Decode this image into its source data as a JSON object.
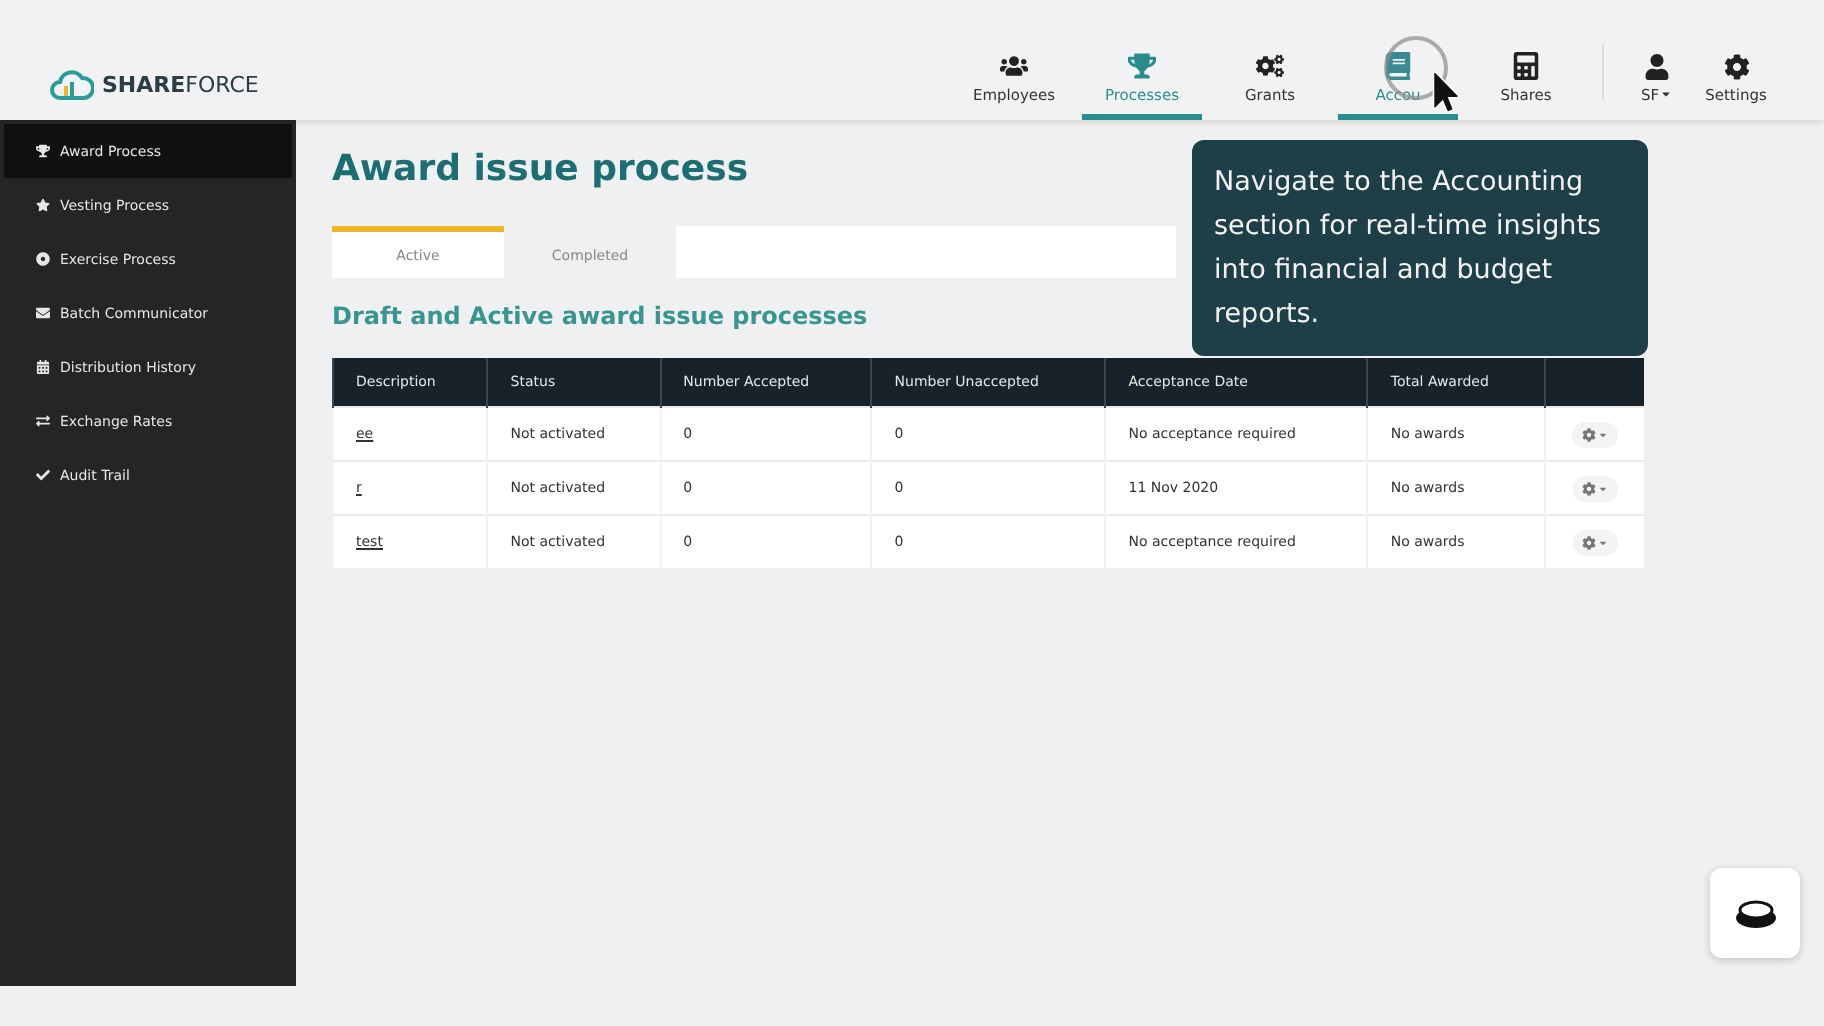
{
  "logo": {
    "text_bold": "SHARE",
    "text_light": "FORCE"
  },
  "nav": [
    {
      "label": "Employees",
      "selected": false,
      "hovered": false
    },
    {
      "label": "Processes",
      "selected": true,
      "hovered": false
    },
    {
      "label": "Grants",
      "selected": false,
      "hovered": false
    },
    {
      "label": "Accou",
      "selected": false,
      "hovered": true
    },
    {
      "label": "Shares",
      "selected": false,
      "hovered": false
    }
  ],
  "user": {
    "label": "SF"
  },
  "settings": {
    "label": "Settings"
  },
  "sidebar": {
    "items": [
      {
        "label": "Award Process",
        "selected": true
      },
      {
        "label": "Vesting Process",
        "selected": false
      },
      {
        "label": "Exercise Process",
        "selected": false
      },
      {
        "label": "Batch Communicator",
        "selected": false
      },
      {
        "label": "Distribution History",
        "selected": false
      },
      {
        "label": "Exchange Rates",
        "selected": false
      },
      {
        "label": "Audit Trail",
        "selected": false
      }
    ]
  },
  "page_title": "Award issue process",
  "tabs": [
    {
      "label": "Active",
      "selected": true
    },
    {
      "label": "Completed",
      "selected": false
    }
  ],
  "section_title": "Draft and Active award issue processes",
  "table": {
    "columns": [
      "Description",
      "Status",
      "Number Accepted",
      "Number Unaccepted",
      "Acceptance Date",
      "Total Awarded"
    ],
    "rows": [
      {
        "cells": [
          "ee",
          "Not activated",
          "0",
          "0",
          "No acceptance required",
          "No awards"
        ]
      },
      {
        "cells": [
          "r",
          "Not activated",
          "0",
          "0",
          "11 Nov 2020",
          "No awards"
        ]
      },
      {
        "cells": [
          "test",
          "Not activated",
          "0",
          "0",
          "No acceptance required",
          "No awards"
        ]
      }
    ]
  },
  "tooltip": "Navigate to the Accounting section for real-time insights into financial and budget reports."
}
